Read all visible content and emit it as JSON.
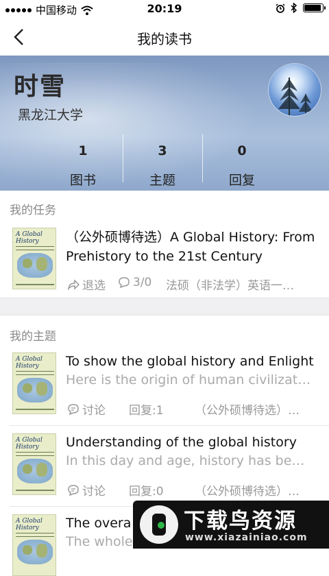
{
  "status_bar": {
    "carrier": "中国移动",
    "time": "20:19"
  },
  "nav": {
    "title": "我的读书"
  },
  "profile": {
    "name": "时雪",
    "school": "黑龙江大学",
    "stats": [
      {
        "count": "1",
        "label": "图书"
      },
      {
        "count": "3",
        "label": "主题"
      },
      {
        "count": "0",
        "label": "回复"
      }
    ]
  },
  "tasks_section": {
    "title": "我的任务",
    "items": [
      {
        "title": "（公外硕博待选）A Global History: From Prehistory to the 21st Century",
        "withdraw_label": "退选",
        "comment_count": "3/0",
        "course": "法硕（非法学）英语一…"
      }
    ]
  },
  "topics_section": {
    "title": "我的主题",
    "items": [
      {
        "title": "To show the global history and Enlight",
        "description": "Here is the origin of human civilizat…",
        "discuss_label": "讨论",
        "replies": "回复:1",
        "group": "（公外硕博待选）…"
      },
      {
        "title": "Understanding of the global history",
        "description": "In this day and age, history has be…",
        "discuss_label": "讨论",
        "replies": "回复:0",
        "group": "（公外硕博待选）…"
      },
      {
        "title": "The overa",
        "description": "The whole"
      }
    ]
  },
  "book_cover": {
    "title_line1": "A Global",
    "title_line2": "History"
  },
  "watermark": {
    "title": "下载鸟资源",
    "url": "www.xiazainiao.com"
  }
}
